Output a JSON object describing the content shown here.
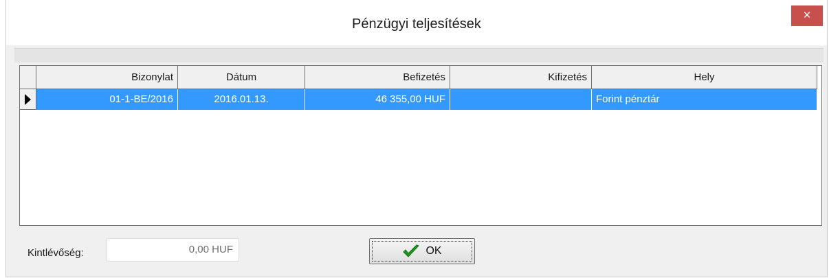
{
  "window": {
    "title": "Pénzügyi teljesítések",
    "close_glyph": "×"
  },
  "grid": {
    "columns": [
      "Bizonylat",
      "Dátum",
      "Befizetés",
      "Kifizetés",
      "Hely"
    ],
    "rows": [
      {
        "bizonylat": "01-1-BE/2016",
        "datum": "2016.01.13.",
        "befizetes": "46 355,00 HUF",
        "kifizetes": "",
        "hely": "Forint pénztár"
      }
    ]
  },
  "footer": {
    "outstanding_label": "Kintlévőség:",
    "outstanding_value": "0,00 HUF",
    "ok_label": "OK"
  },
  "colors": {
    "selection": "#3399ff",
    "close_button": "#c7504c",
    "check_icon": "#1f9a1f"
  },
  "icons": {
    "close": "close-icon",
    "row_indicator": "row-pointer-icon",
    "ok": "checkmark-icon"
  }
}
